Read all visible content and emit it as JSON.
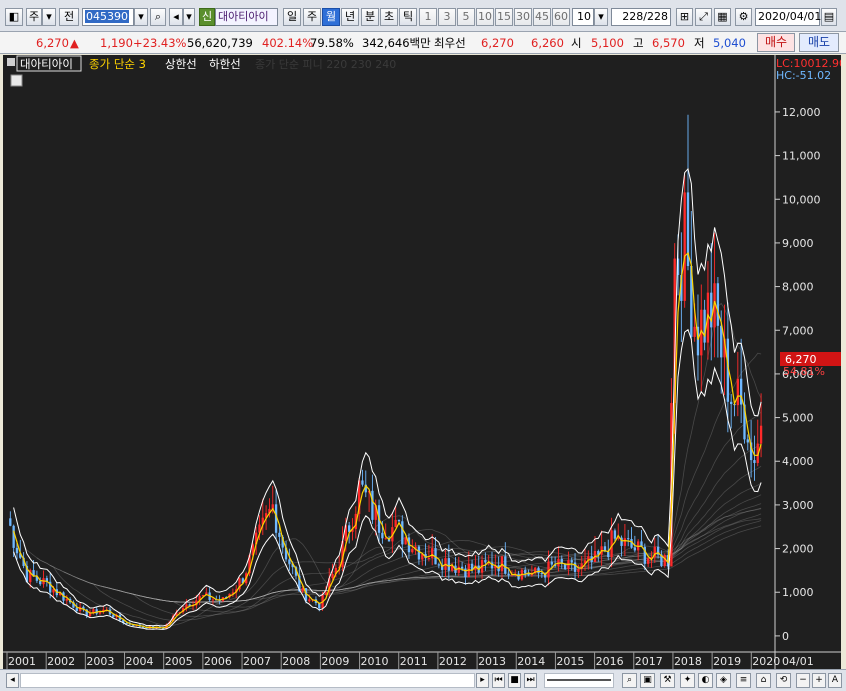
{
  "toolbar": {
    "type_select": "주",
    "jeon_label": "전",
    "stock_code": "045390",
    "sin_label": "신",
    "stock_name": "대아티아이",
    "periods": [
      "일",
      "주",
      "월",
      "년",
      "분",
      "초",
      "틱"
    ],
    "active_period": "월",
    "intervals": [
      "1",
      "3",
      "5",
      "10",
      "15",
      "30",
      "45",
      "60"
    ],
    "interval_value": "10",
    "count_value": "228",
    "count_total": "/228",
    "date_value": "2020/04/01"
  },
  "quote": {
    "price": "6,270",
    "change": "1,190",
    "change_pct": "+23.43%",
    "volume": "56,620,739",
    "vol_ratio": "402.14%",
    "turnover": "79.58%",
    "amount": "342,646백만",
    "best_label": "최우선",
    "best_ask": "6,270",
    "best_bid": "6,260",
    "open_label": "시",
    "open": "5,100",
    "high_label": "고",
    "high": "6,570",
    "low_label": "저",
    "low": "5,040",
    "buy_label": "매수",
    "sell_label": "매도"
  },
  "chart_legend": {
    "stock_name": "대아티아이",
    "ma_label": "종가 단순 3",
    "upper_label": "상한선",
    "lower_label": "하한선",
    "faded_label": "종가 단순 피니 220 230 240",
    "lc_label": "LC:10012.90",
    "hc_label": "HC:-51.02",
    "price_tag": "6,270",
    "pct_tag": "54.81%"
  },
  "colors": {
    "up": "#ff2a2a",
    "down": "#6fb8ff",
    "ma": "#ffd400",
    "band": "#ffffff",
    "price_tag_bg": "#d21414"
  },
  "chart_data": {
    "type": "line",
    "title": "",
    "xlabel": "",
    "ylabel": "",
    "x_ticks": [
      "2001",
      "2002",
      "2003",
      "2004",
      "2005",
      "2006",
      "2007",
      "2008",
      "2009",
      "2010",
      "2011",
      "2012",
      "2013",
      "2014",
      "2015",
      "2016",
      "2017",
      "2018",
      "2019",
      "2020"
    ],
    "last_x_label": "04/01",
    "y_ticks": [
      "0",
      "1,000",
      "2,000",
      "3,000",
      "4,000",
      "5,000",
      "6,000",
      "7,000",
      "8,000",
      "9,000",
      "10,000",
      "11,000",
      "12,000"
    ],
    "ylim": [
      -300,
      12800
    ],
    "series": [
      {
        "name": "종가 단순 3",
        "x": [
          2001,
          2001.5,
          2002,
          2002.5,
          2003,
          2003.5,
          2004,
          2004.5,
          2005,
          2005.5,
          2006,
          2006.5,
          2007,
          2007.5,
          2007.8,
          2008,
          2008.5,
          2009,
          2009.5,
          2010,
          2010.5,
          2011,
          2011.5,
          2012,
          2012.5,
          2013,
          2013.5,
          2014,
          2014.5,
          2015,
          2015.5,
          2016,
          2016.5,
          2017,
          2017.5,
          2017.9,
          2018,
          2018.3,
          2018.6,
          2019,
          2019.5,
          2019.9,
          2020,
          2020.25
        ],
        "values": [
          2700,
          1400,
          1200,
          850,
          500,
          600,
          300,
          200,
          180,
          700,
          900,
          800,
          1300,
          2400,
          3000,
          2200,
          1000,
          700,
          1800,
          3400,
          2600,
          2400,
          2000,
          1800,
          1600,
          1500,
          1700,
          1500,
          1400,
          1600,
          1500,
          1700,
          2200,
          2000,
          1800,
          1750,
          8500,
          9000,
          7000,
          7500,
          5500,
          5000,
          4000,
          4800
        ]
      }
    ],
    "grid": false
  },
  "scroll": {
    "first_icon": "first-icon",
    "prev_icon": "prev-icon",
    "stop_icon": "stop-icon",
    "next_icon": "next-icon",
    "last_icon": "last-icon"
  }
}
